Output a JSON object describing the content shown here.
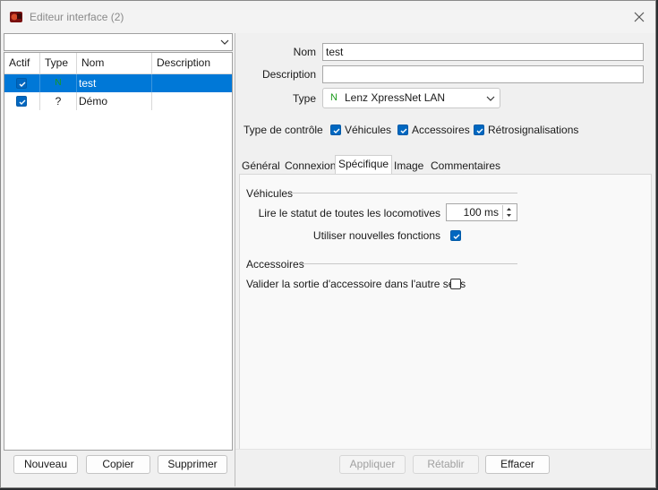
{
  "window": {
    "title": "Editeur interface (2)"
  },
  "list": {
    "filter_value": "",
    "columns": [
      "Actif",
      "Type",
      "Nom",
      "Description"
    ],
    "rows": [
      {
        "actif": true,
        "type": "N",
        "nom": "test",
        "description": "",
        "selected": true
      },
      {
        "actif": true,
        "type": "?",
        "nom": "Démo",
        "description": "",
        "selected": false
      }
    ]
  },
  "left_buttons": {
    "new": "Nouveau",
    "copy": "Copier",
    "delete": "Supprimer"
  },
  "form": {
    "nom_label": "Nom",
    "nom_value": "test",
    "description_label": "Description",
    "description_value": "",
    "type_label": "Type",
    "type_icon": "N",
    "type_value": "Lenz XpressNet LAN",
    "control_label": "Type de contrôle",
    "control": [
      {
        "label": "Véhicules",
        "checked": true
      },
      {
        "label": "Accessoires",
        "checked": true
      },
      {
        "label": "Rétrosignalisations",
        "checked": true
      }
    ]
  },
  "tabs": [
    "Général",
    "Connexion",
    "Spécifique",
    "Image",
    "Commentaires"
  ],
  "active_tab": "Spécifique",
  "specific": {
    "vehicles_group": "Véhicules",
    "loco_status_label": "Lire le statut de toutes les locomotives",
    "loco_status_value": "100 ms",
    "new_functions_label": "Utiliser nouvelles fonctions",
    "new_functions_checked": true,
    "accessories_group": "Accessoires",
    "validate_output_label": "Valider la sortie d'accessoire dans l'autre sens",
    "validate_output_checked": false
  },
  "right_buttons": {
    "apply": "Appliquer",
    "restore": "Rétablir",
    "clear": "Effacer"
  },
  "colors": {
    "accent": "#0067c0",
    "selection": "#0078d7",
    "type_n": "#1a9a1a"
  }
}
